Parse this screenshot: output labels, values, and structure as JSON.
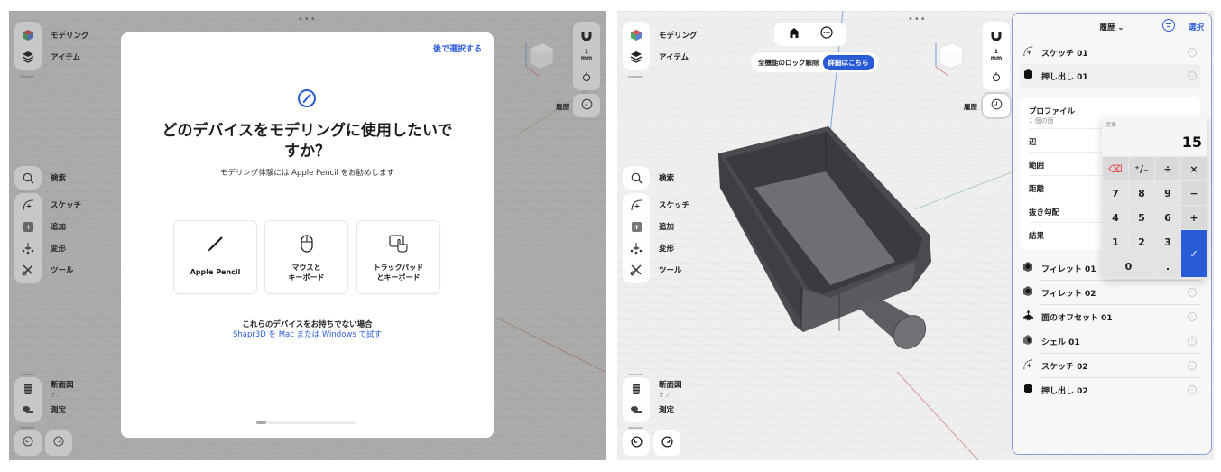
{
  "left_screen": {
    "grabber": "•••",
    "sidebar": {
      "top_items": [
        {
          "label": "モデリング",
          "icon": "modeling-cube-icon"
        },
        {
          "label": "アイテム",
          "icon": "layers-icon"
        }
      ],
      "search": {
        "label": "検索",
        "icon": "search-icon"
      },
      "tools": [
        {
          "label": "スケッチ",
          "icon": "sketch-icon"
        },
        {
          "label": "追加",
          "icon": "add-icon"
        },
        {
          "label": "変形",
          "icon": "transform-icon"
        },
        {
          "label": "ツール",
          "icon": "tools-icon"
        }
      ],
      "bottom": [
        {
          "label": "断面図",
          "sub": "オフ",
          "icon": "section-view-icon"
        },
        {
          "label": "測定",
          "icon": "measure-icon"
        }
      ],
      "undo_icon": "undo-icon",
      "redo_icon": "redo-icon"
    },
    "right_rail": {
      "snap_icon": "magnet-icon",
      "unit_value": "1",
      "unit": "mm",
      "view_icon": "perspective-icon",
      "history_label": "履歴",
      "history_icon": "clock-icon"
    },
    "modal": {
      "skip_link": "後で選択する",
      "header_icon": "pencil-circle-icon",
      "title": "どのデバイスをモデリングに使用したいですか？",
      "subtitle": "モデリング体験には Apple Pencil をお勧めします",
      "devices": [
        {
          "label": "Apple Pencil",
          "icon": "pencil-icon"
        },
        {
          "label": "マウスと\nキーボード",
          "icon": "mouse-icon"
        },
        {
          "label": "トラックパッド\nとキーボード",
          "icon": "trackpad-icon"
        }
      ],
      "no_device_text": "これらのデバイスをお持ちでない場合",
      "try_link": "Shapr3D を Mac または Windows で試す",
      "page_progress": 0.1
    }
  },
  "right_screen": {
    "grabber": "•••",
    "top_toolbar": {
      "home_icon": "home-icon",
      "more_icon": "more-icon"
    },
    "unlock_banner": {
      "text": "全機能のロック解除",
      "button": "詳細はこちら"
    },
    "sidebar": {
      "top_items": [
        {
          "label": "モデリング"
        },
        {
          "label": "アイテム"
        }
      ],
      "search": {
        "label": "検索"
      },
      "tools": [
        {
          "label": "スケッチ"
        },
        {
          "label": "追加"
        },
        {
          "label": "変形"
        },
        {
          "label": "ツール"
        }
      ],
      "bottom": [
        {
          "label": "断面図",
          "sub": "オフ"
        },
        {
          "label": "測定"
        }
      ]
    },
    "right_rail": {
      "unit_value": "1",
      "unit": "mm",
      "history_label": "履歴"
    },
    "history_panel": {
      "title": "履歴 ⌄",
      "select": "選択",
      "items": [
        {
          "name": "スケッチ 01",
          "icon": "sketch-icon"
        },
        {
          "name": "押し出し 01",
          "icon": "extrude-icon",
          "selected": true
        },
        {
          "name": "フィレット 01",
          "icon": "fillet-icon"
        },
        {
          "name": "フィレット 02",
          "icon": "fillet-icon"
        },
        {
          "name": "面のオフセット 01",
          "icon": "offset-face-icon"
        },
        {
          "name": "シェル 01",
          "icon": "shell-icon"
        },
        {
          "name": "スケッチ 02",
          "icon": "sketch-icon"
        },
        {
          "name": "押し出し 02",
          "icon": "extrude-icon"
        }
      ],
      "properties": [
        {
          "label": "プロファイル",
          "sub": "1 個の面"
        },
        {
          "label": "辺"
        },
        {
          "label": "範囲"
        },
        {
          "label": "距離"
        },
        {
          "label": "抜き勾配"
        },
        {
          "label": "結果"
        }
      ]
    },
    "keypad": {
      "label": "距離",
      "value": "15",
      "keys": {
        "backspace": "⌫",
        "sign": "⁺∕₋",
        "divide": "÷",
        "multiply": "×",
        "minus": "−",
        "plus": "+",
        "decimal": ".",
        "enter": "✓",
        "digits": [
          "0",
          "1",
          "2",
          "3",
          "4",
          "5",
          "6",
          "7",
          "8",
          "9"
        ]
      }
    }
  }
}
